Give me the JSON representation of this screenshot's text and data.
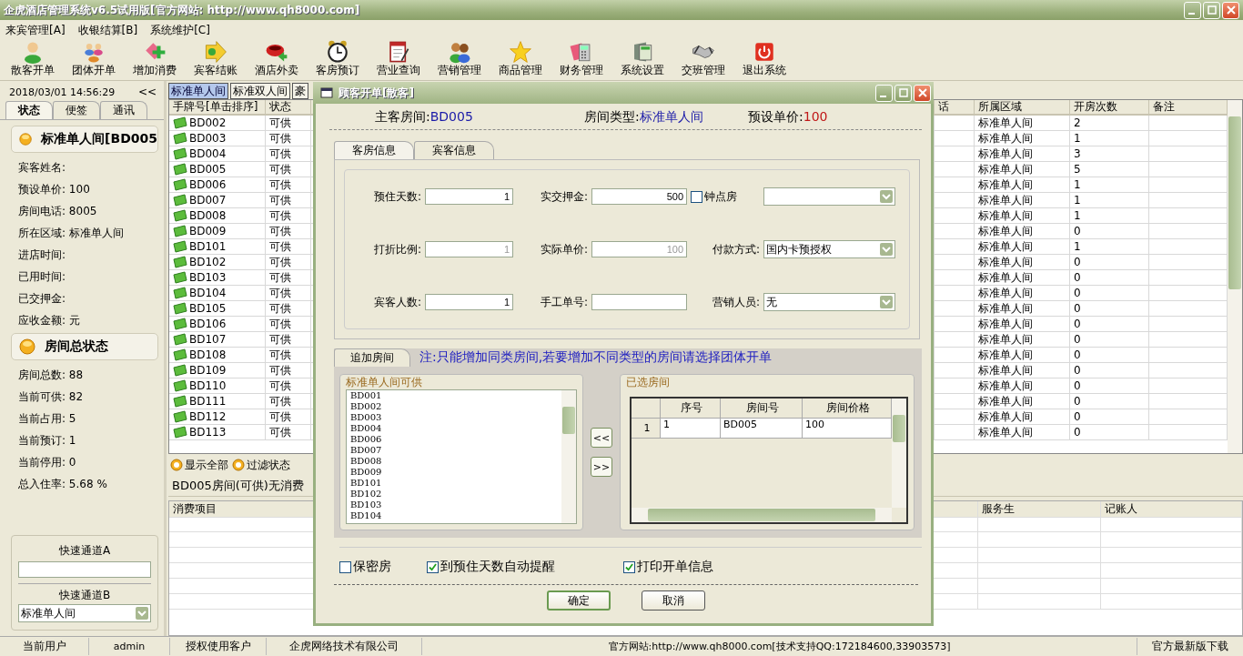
{
  "window": {
    "title": "企虎酒店管理系统v6.5试用版[官方网站: http://www.qh8000.com]"
  },
  "menu": [
    {
      "label": "来宾管理[A]"
    },
    {
      "label": "收银结算[B]"
    },
    {
      "label": "系统维护[C]"
    }
  ],
  "toolbar": [
    {
      "label": "散客开单"
    },
    {
      "label": "团体开单"
    },
    {
      "label": "增加消费"
    },
    {
      "label": "宾客结账"
    },
    {
      "label": "酒店外卖"
    },
    {
      "label": "客房预订"
    },
    {
      "label": "营业查询"
    },
    {
      "label": "营销管理"
    },
    {
      "label": "商品管理"
    },
    {
      "label": "财务管理"
    },
    {
      "label": "系统设置"
    },
    {
      "label": "交班管理"
    },
    {
      "label": "退出系统"
    }
  ],
  "left_panel": {
    "datetime": "2018/03/01 14:56:29",
    "collapse": "<<",
    "tabs": [
      {
        "label": "状态",
        "selected": true
      },
      {
        "label": "便签",
        "selected": false
      },
      {
        "label": "通讯",
        "selected": false
      }
    ],
    "room_group": {
      "title": "标准单人间[BD005",
      "fields": [
        "宾客姓名:",
        "预设单价: 100",
        "房间电话: 8005",
        "所在区域: 标准单人间",
        "进店时间:",
        "已用时间:",
        "已交押金:",
        "应收金额: 元"
      ]
    },
    "total_group": {
      "title": "房间总状态",
      "fields": [
        "房间总数: 88",
        "当前可供: 82",
        "当前占用: 5",
        "当前预订: 1",
        "当前停用: 0",
        "总入住率: 5.68 %"
      ]
    },
    "quick_a": {
      "label": "快速通道A"
    },
    "quick_b": {
      "label": "快速通道B",
      "value": "标准单人间"
    }
  },
  "room_tabs": [
    {
      "label": "标准单人间",
      "selected": true
    },
    {
      "label": "标准双人间",
      "selected": false
    },
    {
      "label": "豪",
      "selected": false
    }
  ],
  "room_table": {
    "left_columns": [
      "手牌号[单击排序]",
      "状态"
    ],
    "right_columns": [
      "话",
      "所属区域",
      "开房次数",
      "备注"
    ],
    "rows": [
      {
        "number": "BD002",
        "status": "可供",
        "area": "标准单人间",
        "count": "2"
      },
      {
        "number": "BD003",
        "status": "可供",
        "area": "标准单人间",
        "count": "1"
      },
      {
        "number": "BD004",
        "status": "可供",
        "area": "标准单人间",
        "count": "3"
      },
      {
        "number": "BD005",
        "status": "可供",
        "area": "标准单人间",
        "count": "5"
      },
      {
        "number": "BD006",
        "status": "可供",
        "area": "标准单人间",
        "count": "1"
      },
      {
        "number": "BD007",
        "status": "可供",
        "area": "标准单人间",
        "count": "1"
      },
      {
        "number": "BD008",
        "status": "可供",
        "area": "标准单人间",
        "count": "1"
      },
      {
        "number": "BD009",
        "status": "可供",
        "area": "标准单人间",
        "count": "0"
      },
      {
        "number": "BD101",
        "status": "可供",
        "area": "标准单人间",
        "count": "1"
      },
      {
        "number": "BD102",
        "status": "可供",
        "area": "标准单人间",
        "count": "0"
      },
      {
        "number": "BD103",
        "status": "可供",
        "area": "标准单人间",
        "count": "0"
      },
      {
        "number": "BD104",
        "status": "可供",
        "area": "标准单人间",
        "count": "0"
      },
      {
        "number": "BD105",
        "status": "可供",
        "area": "标准单人间",
        "count": "0"
      },
      {
        "number": "BD106",
        "status": "可供",
        "area": "标准单人间",
        "count": "0"
      },
      {
        "number": "BD107",
        "status": "可供",
        "area": "标准单人间",
        "count": "0"
      },
      {
        "number": "BD108",
        "status": "可供",
        "area": "标准单人间",
        "count": "0"
      },
      {
        "number": "BD109",
        "status": "可供",
        "area": "标准单人间",
        "count": "0"
      },
      {
        "number": "BD110",
        "status": "可供",
        "area": "标准单人间",
        "count": "0"
      },
      {
        "number": "BD111",
        "status": "可供",
        "area": "标准单人间",
        "count": "0"
      },
      {
        "number": "BD112",
        "status": "可供",
        "area": "标准单人间",
        "count": "0"
      },
      {
        "number": "BD113",
        "status": "可供",
        "area": "标准单人间",
        "count": "0"
      }
    ]
  },
  "filters": [
    {
      "label": "显示全部"
    },
    {
      "label": "过滤状态"
    }
  ],
  "consumption": {
    "caption": "BD005房间(可供)无消费",
    "left_columns": [
      "消费项目"
    ],
    "right_columns": [
      "服务生",
      "记账人"
    ]
  },
  "status_bar": [
    "当前用户",
    "admin",
    "授权使用客户",
    "企虎网络技术有限公司",
    "官方网站:http://www.qh8000.com[技术支持QQ:172184600,33903573]",
    "官方最新版下载"
  ],
  "dialog": {
    "title": "顾客开单[散客]",
    "summary": [
      {
        "label": "主客房间:",
        "value": "BD005",
        "kind": "info"
      },
      {
        "label": "房间类型:",
        "value": "标准单人间",
        "kind": "info"
      },
      {
        "label": "预设单价:",
        "value": "100",
        "kind": "price"
      }
    ],
    "tabs": [
      {
        "label": "客房信息",
        "selected": true
      },
      {
        "label": "宾客信息",
        "selected": false
      }
    ],
    "fields": [
      {
        "label": "预住天数:",
        "value": "1",
        "kind": "input"
      },
      {
        "label": "实交押金:",
        "value": "500",
        "kind": "input"
      },
      {
        "label": "钟点房",
        "checked": false,
        "kind": "check_select"
      },
      {
        "label": "打折比例:",
        "value": "1",
        "kind": "readonly"
      },
      {
        "label": "实际单价:",
        "value": "100",
        "kind": "readonly"
      },
      {
        "label": "付款方式:",
        "value": "国内卡预授权",
        "kind": "select"
      },
      {
        "label": "宾客人数:",
        "value": "1",
        "kind": "input"
      },
      {
        "label": "手工单号:",
        "kind": "input"
      },
      {
        "label": "营销人员:",
        "value": "无",
        "kind": "select"
      }
    ],
    "add_tab": {
      "label": "追加房间"
    },
    "note": "注:只能增加同类房间,若要增加不同类型的房间请选择团体开单",
    "available": {
      "title": "标准单人间可供",
      "items": [
        "BD001",
        "BD002",
        "BD003",
        "BD004",
        "BD006",
        "BD007",
        "BD008",
        "BD009",
        "BD101",
        "BD102",
        "BD103",
        "BD104"
      ]
    },
    "move_buttons": [
      "<<",
      ">>"
    ],
    "selected_rooms": {
      "title": "已选房间",
      "columns": [
        "序号",
        "房间号",
        "房间价格"
      ],
      "rows": [
        {
          "index": "1",
          "cells": [
            "1",
            "BD005",
            "100"
          ]
        }
      ]
    },
    "options": [
      {
        "label": "保密房",
        "checked": false
      },
      {
        "label": "到预住天数自动提醒",
        "checked": true
      },
      {
        "label": "打印开单信息",
        "checked": true
      }
    ],
    "buttons": [
      {
        "label": "确定",
        "default": true
      },
      {
        "label": "取消",
        "default": false
      }
    ]
  }
}
